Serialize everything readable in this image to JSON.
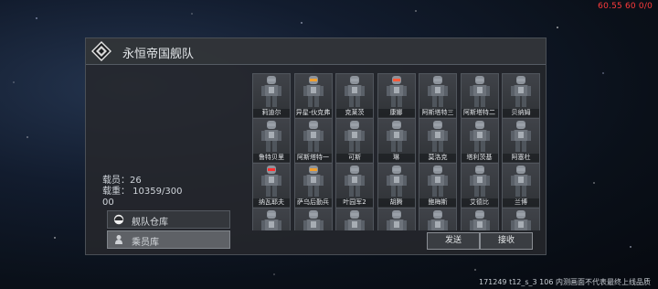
{
  "perf_overlay": "60.55 60 0/0",
  "panel": {
    "title": "永恒帝国舰队",
    "crew_label": "载员：26",
    "capacity_label": "载重：  10359/300",
    "capacity_overflow": "00"
  },
  "tabs": [
    {
      "label": "舰队仓库",
      "icon": "warehouse-icon",
      "active": false
    },
    {
      "label": "乘员库",
      "icon": "crew-icon",
      "active": true
    }
  ],
  "crew": [
    {
      "name": "莉迪尔",
      "visor": "#9aa0a8"
    },
    {
      "name": "异星-伙克弗",
      "visor": "#f0a030"
    },
    {
      "name": "克莱茨",
      "visor": "#9aa0a8"
    },
    {
      "name": "康娜",
      "visor": "#ff5a3a"
    },
    {
      "name": "阿斯塔特三",
      "visor": "#9aa0a8"
    },
    {
      "name": "阿斯塔特二",
      "visor": "#9aa0a8"
    },
    {
      "name": "贝纳姆",
      "visor": "#9aa0a8"
    },
    {
      "name": "鲁特贝里",
      "visor": "#9aa0a8"
    },
    {
      "name": "阿斯塔特一",
      "visor": "#9aa0a8"
    },
    {
      "name": "可斯",
      "visor": "#9aa0a8"
    },
    {
      "name": "琳",
      "visor": "#9aa0a8"
    },
    {
      "name": "莫洛克",
      "visor": "#9aa0a8"
    },
    {
      "name": "塔利茨基",
      "visor": "#9aa0a8"
    },
    {
      "name": "阿塞杜",
      "visor": "#9aa0a8"
    },
    {
      "name": "纳瓦耶夫",
      "visor": "#ff3030"
    },
    {
      "name": "萨乌后勤兵",
      "visor": "#f0a030"
    },
    {
      "name": "叶园军2",
      "visor": "#9aa0a8"
    },
    {
      "name": "胡腾",
      "visor": "#9aa0a8"
    },
    {
      "name": "鲍梅斯",
      "visor": "#9aa0a8"
    },
    {
      "name": "艾德比",
      "visor": "#9aa0a8"
    },
    {
      "name": "兰博",
      "visor": "#9aa0a8"
    },
    {
      "name": "",
      "visor": "#9aa0a8"
    },
    {
      "name": "",
      "visor": "#9aa0a8"
    },
    {
      "name": "",
      "visor": "#9aa0a8"
    },
    {
      "name": "",
      "visor": "#9aa0a8"
    },
    {
      "name": "",
      "visor": "#9aa0a8"
    },
    {
      "name": "",
      "visor": "#9aa0a8"
    },
    {
      "name": "",
      "visor": "#9aa0a8"
    }
  ],
  "buttons": {
    "send": "发送",
    "receive": "接收"
  },
  "footer": "171249 t12_s_3 106  内测画面不代表最终上线品质",
  "colors": {
    "perf_overlay": "#ff3b3b",
    "panel_bg": "#26282c"
  }
}
